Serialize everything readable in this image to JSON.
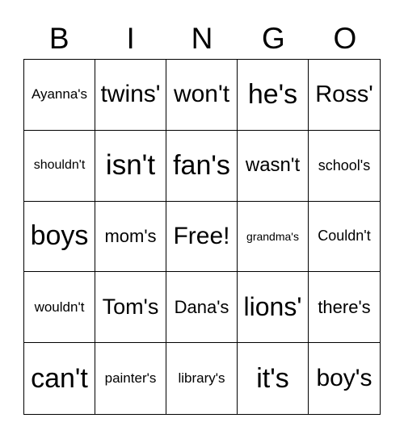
{
  "header": [
    "B",
    "I",
    "N",
    "G",
    "O"
  ],
  "cells": [
    "Ayanna's",
    "twins'",
    "won't",
    "he's",
    "Ross'",
    "shouldn't",
    "isn't",
    "fan's",
    "wasn't",
    "school's",
    "boys",
    "mom's",
    "Free!",
    "grandma's",
    "Couldn't",
    "wouldn't",
    "Tom's",
    "Dana's",
    "lions'",
    "there's",
    "can't",
    "painter's",
    "library's",
    "it's",
    "boy's"
  ]
}
